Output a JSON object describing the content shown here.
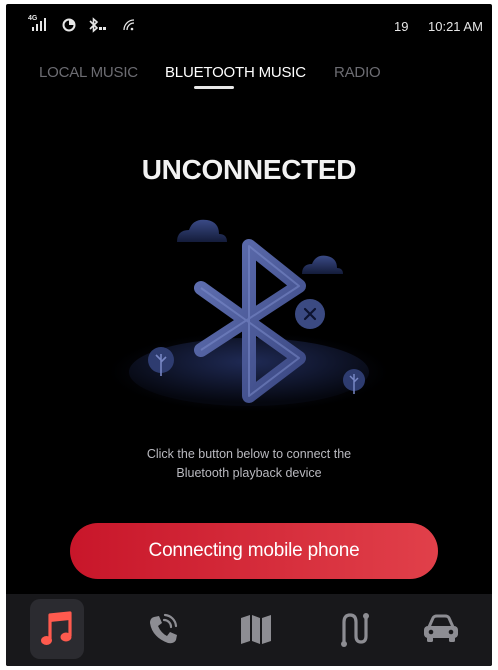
{
  "status_bar": {
    "network_label": "4G",
    "icons": [
      "signal-icon",
      "vpn-icon",
      "bluetooth-battery-icon",
      "wifi-icon"
    ],
    "count": "19",
    "time": "10:21 AM"
  },
  "tabs": [
    {
      "label": "LOCAL MUSIC",
      "active": false
    },
    {
      "label": "BLUETOOTH MUSIC",
      "active": true
    },
    {
      "label": "RADIO",
      "active": false
    }
  ],
  "main": {
    "title": "UNCONNECTED",
    "hint_line1": "Click the button below to connect the",
    "hint_line2": "Bluetooth playback device",
    "connect_button": "Connecting mobile phone",
    "illustration_icons": [
      "bluetooth-icon",
      "disconnected-x-icon",
      "cloud-icon",
      "tree-icon"
    ]
  },
  "dock": {
    "items": [
      {
        "name": "music-icon",
        "active": true
      },
      {
        "name": "phone-icon",
        "active": false
      },
      {
        "name": "map-icon",
        "active": false
      },
      {
        "name": "route-icon",
        "active": false
      },
      {
        "name": "car-icon",
        "active": false
      }
    ],
    "expand_icon": "chevron-up-icon"
  },
  "colors": {
    "background": "#000000",
    "accent_red": "#d42a38",
    "dock_background": "#18181b",
    "bluetooth_blue": "#4f5f9c"
  }
}
